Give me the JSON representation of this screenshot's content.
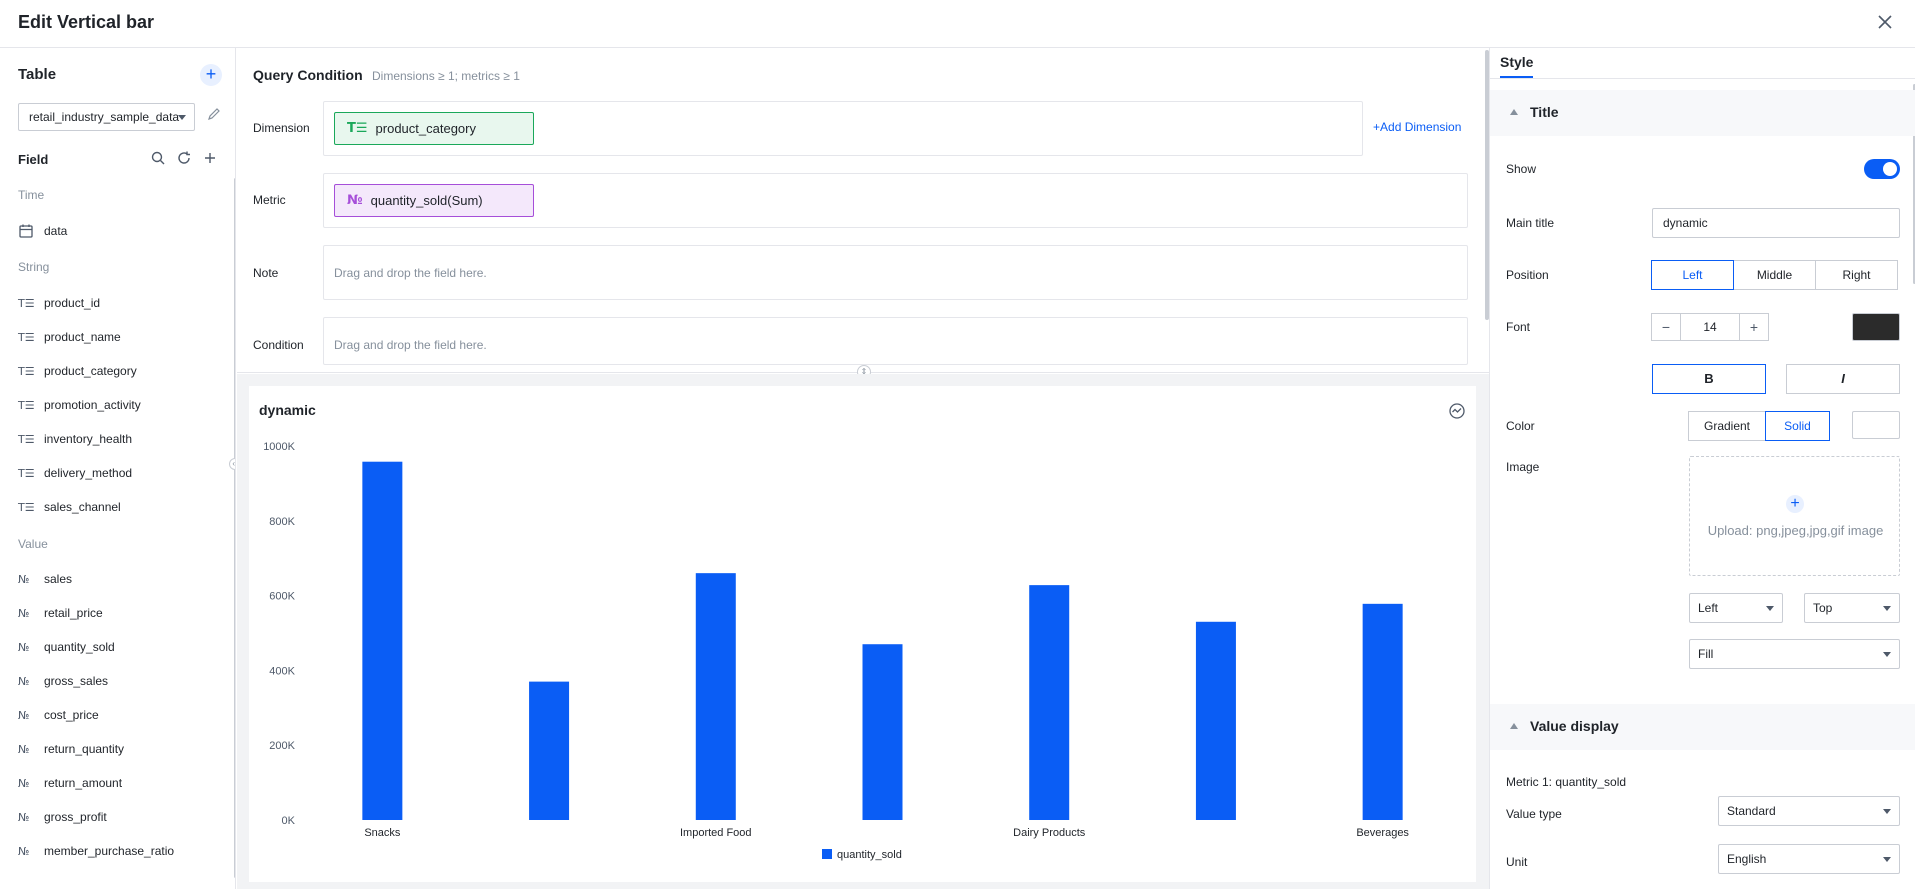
{
  "window": {
    "title": "Edit Vertical bar"
  },
  "left": {
    "table_heading": "Table",
    "table_add": "+",
    "table_select": "retail_industry_sample_data",
    "field_heading": "Field",
    "groups": {
      "time": "Time",
      "string": "String",
      "value": "Value"
    },
    "time_fields": [
      {
        "icon": "calendar-icon",
        "label": "data"
      }
    ],
    "string_fields": [
      {
        "icon": "text-field-icon",
        "label": "product_id"
      },
      {
        "icon": "text-field-icon",
        "label": "product_name"
      },
      {
        "icon": "text-field-icon",
        "label": "product_category"
      },
      {
        "icon": "text-field-icon",
        "label": "promotion_activity"
      },
      {
        "icon": "text-field-icon",
        "label": "inventory_health"
      },
      {
        "icon": "text-field-icon",
        "label": "delivery_method"
      },
      {
        "icon": "text-field-icon",
        "label": "sales_channel"
      }
    ],
    "value_fields": [
      {
        "icon": "number-field-icon",
        "label": "sales"
      },
      {
        "icon": "number-field-icon",
        "label": "retail_price"
      },
      {
        "icon": "number-field-icon",
        "label": "quantity_sold"
      },
      {
        "icon": "number-field-icon",
        "label": "gross_sales"
      },
      {
        "icon": "number-field-icon",
        "label": "cost_price"
      },
      {
        "icon": "number-field-icon",
        "label": "return_quantity"
      },
      {
        "icon": "number-field-icon",
        "label": "return_amount"
      },
      {
        "icon": "number-field-icon",
        "label": "gross_profit"
      },
      {
        "icon": "number-field-icon",
        "label": "member_purchase_ratio"
      }
    ]
  },
  "query": {
    "heading": "Query Condition",
    "hint": "Dimensions ≥ 1; metrics ≥ 1",
    "dimension_label": "Dimension",
    "dimension_chip": "product_category",
    "add_dimension": "Add Dimension",
    "metric_label": "Metric",
    "metric_chip": "quantity_sold(Sum)",
    "note_label": "Note",
    "note_placeholder": "Drag and drop the field here.",
    "condition_label": "Condition",
    "condition_placeholder": "Drag and drop the field here."
  },
  "chart_data": {
    "type": "bar",
    "title": "dynamic",
    "categories": [
      "Snacks",
      "",
      "Imported Food",
      "",
      "Dairy Products",
      "",
      "Beverages"
    ],
    "series": [
      {
        "name": "quantity_sold",
        "values": [
          958000,
          370000,
          660000,
          470000,
          628000,
          530000,
          578000
        ]
      }
    ],
    "yticks": [
      "0K",
      "200K",
      "400K",
      "600K",
      "800K",
      "1000K"
    ],
    "ylim": [
      0,
      1000000
    ],
    "color": "#0a5df5",
    "legend_position": "bottom"
  },
  "style": {
    "tab": "Style",
    "title_section": "Title",
    "show_label": "Show",
    "show_on": true,
    "main_title_label": "Main title",
    "main_title_value": "dynamic",
    "position_label": "Position",
    "position_options": [
      "Left",
      "Middle",
      "Right"
    ],
    "position_selected": "Left",
    "font_label": "Font",
    "font_minus": "−",
    "font_size": "14",
    "font_plus": "+",
    "font_color": "#2b2b2b",
    "bold": "B",
    "italic": "I",
    "color_label": "Color",
    "color_options": [
      "Gradient",
      "Solid"
    ],
    "color_selected": "Solid",
    "color_swatch": "#ffffff",
    "image_label": "Image",
    "upload_text": "Upload: png,jpeg,jpg,gif image",
    "h_align": "Left",
    "v_align": "Top",
    "fill_mode": "Fill",
    "value_section": "Value display",
    "metric_1": "Metric 1: quantity_sold",
    "value_type_label": "Value type",
    "value_type": "Standard",
    "unit_label": "Unit",
    "unit": "English"
  }
}
